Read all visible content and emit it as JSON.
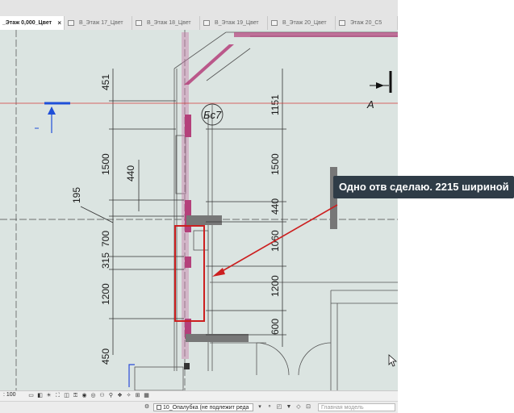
{
  "tabs": [
    {
      "label": "_Этаж 0,000_Цвет",
      "active": true
    },
    {
      "label": "В_Этаж 17_Цвет",
      "active": false
    },
    {
      "label": "В_Этаж 18_Цвет",
      "active": false
    },
    {
      "label": "В_Этаж 19_Цвет",
      "active": false
    },
    {
      "label": "В_Этаж 20_Цвет",
      "active": false
    },
    {
      "label": "Этаж 20_С5",
      "active": false
    }
  ],
  "close_glyph": "×",
  "drawing": {
    "dims_left": [
      "451",
      "1500",
      "440",
      "195",
      "700",
      "315",
      "1200",
      "450"
    ],
    "dims_right": [
      "1151",
      "1500",
      "440",
      "1060",
      "1200",
      "600"
    ],
    "bubble_label": "Бс7",
    "section_label": "A"
  },
  "tooltip": {
    "text": "Одно отв сделаю. 2215 шириной"
  },
  "statusbar": {
    "scale": ": 100",
    "icons": [
      "display-style-icon",
      "shadows-icon",
      "sun-path-icon",
      "crop-icon",
      "show-crop-icon",
      "lock-3d-icon",
      "temporary-hide-icon",
      "reveal-hidden-icon",
      "worksharing-icon",
      "analysis-icon",
      "design-options-icon",
      "highlight-icon",
      "constraints-icon",
      "grid-icon"
    ]
  },
  "bottombar": {
    "model_select": "10_Опалубка (не подлежит реда",
    "main_model_placeholder": "Главная модель"
  },
  "colors": {
    "canvas": "#dbe4e1",
    "wall_magenta": "#b4407a",
    "markup_red": "#cc1f1f",
    "tooltip_bg": "#2f3c47",
    "section_blue": "#1f4fd8"
  }
}
